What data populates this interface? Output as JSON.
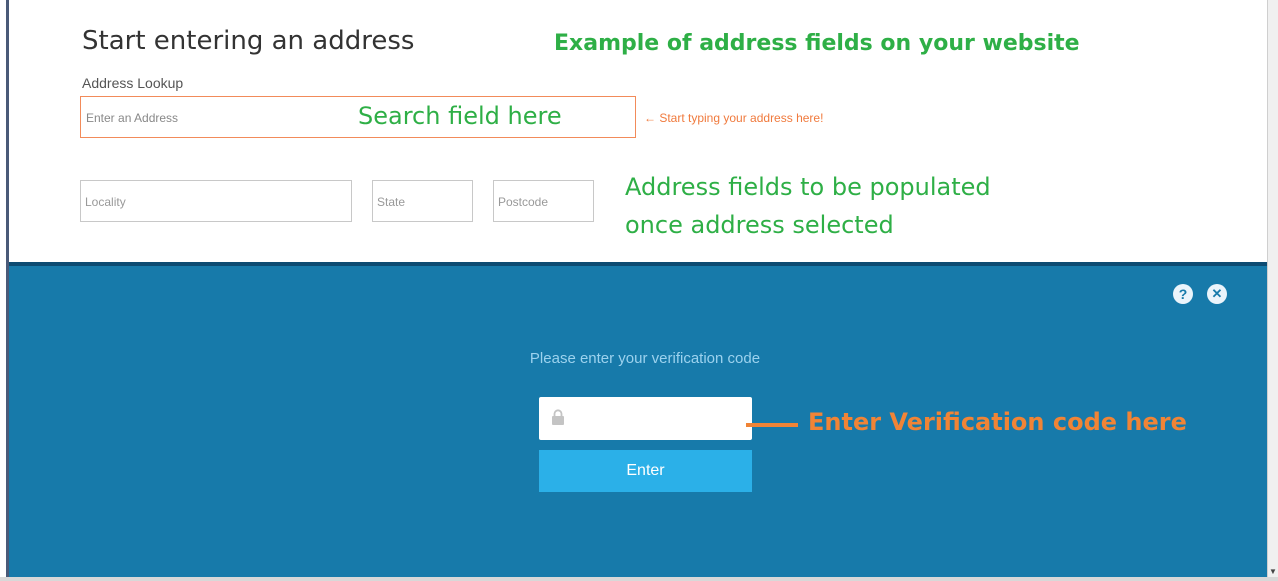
{
  "form": {
    "title": "Start entering an address",
    "lookup_label": "Address Lookup",
    "search_placeholder": "Enter an Address",
    "locality_placeholder": "Locality",
    "state_placeholder": "State",
    "postcode_placeholder": "Postcode"
  },
  "annotations": {
    "example_title": "Example of address fields on your website",
    "search_field": "Search field here",
    "start_typing": "← Start typing your address here!",
    "fields_line1": "Address fields to be populated",
    "fields_line2": "once address selected",
    "verification": "Enter Verification code here"
  },
  "verification": {
    "prompt": "Please enter your verification code",
    "enter_button": "Enter",
    "help_icon": "help-icon",
    "close_icon": "close-icon",
    "lock_icon": "lock-icon"
  },
  "colors": {
    "annotation_green": "#2eaf46",
    "annotation_orange": "#f08436",
    "panel_blue": "#177aaa",
    "button_blue": "#2bb0e8"
  }
}
